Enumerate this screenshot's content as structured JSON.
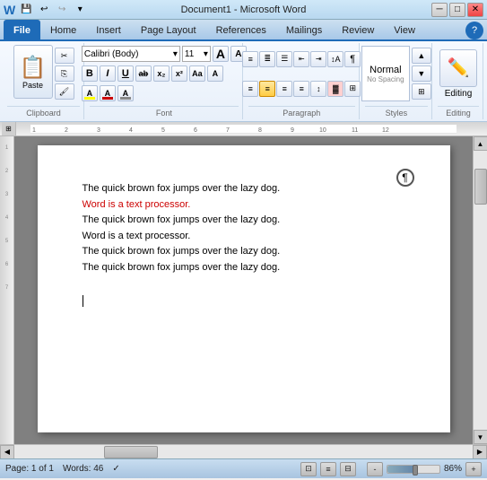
{
  "titlebar": {
    "title": "Document1 - Microsoft Word",
    "min_btn": "─",
    "max_btn": "□",
    "close_btn": "✕"
  },
  "quickaccess": {
    "save_btn": "💾",
    "undo_btn": "↩",
    "redo_btn": "↪",
    "dropdown_btn": "▾"
  },
  "tabs": [
    {
      "label": "File",
      "active": true,
      "id": "file"
    },
    {
      "label": "Home",
      "active": false,
      "id": "home"
    },
    {
      "label": "Insert",
      "active": false,
      "id": "insert"
    },
    {
      "label": "Page Layout",
      "active": false,
      "id": "page-layout"
    },
    {
      "label": "References",
      "active": false,
      "id": "references"
    },
    {
      "label": "Mailings",
      "active": false,
      "id": "mailings"
    },
    {
      "label": "Review",
      "active": false,
      "id": "review"
    },
    {
      "label": "View",
      "active": false,
      "id": "view"
    }
  ],
  "ribbon": {
    "clipboard_group": {
      "label": "Clipboard",
      "paste_label": "Paste",
      "cut_label": "✂",
      "copy_label": "⎘",
      "format_painter_label": "🖌"
    },
    "font_group": {
      "label": "Font",
      "font_name": "Calibri (Body)",
      "font_size": "11",
      "bold": "B",
      "italic": "I",
      "underline": "U",
      "strikethrough": "ab",
      "subscript": "x₂",
      "superscript": "x²",
      "change_case": "Aa",
      "grow": "A",
      "shrink": "A",
      "text_highlight": "A",
      "font_color": "A"
    },
    "paragraph_group": {
      "label": "Paragraph",
      "bullets": "≡",
      "numbering": "≣",
      "multilevel": "☰",
      "decrease_indent": "←",
      "increase_indent": "→",
      "sort": "↕",
      "show_hide": "¶",
      "align_left": "◧",
      "align_center": "▣",
      "align_right": "◨",
      "justify": "⊟",
      "line_spacing": "↕",
      "shading": "▓",
      "borders": "⊞"
    },
    "styles_group": {
      "label": "Styles",
      "normal": "Normal",
      "no_spacing": "No Spacing"
    },
    "editing_group": {
      "label": "Editing",
      "icon": "✏"
    }
  },
  "document": {
    "lines": [
      {
        "text": "The quick brown fox jumps over the lazy dog.",
        "color": "black"
      },
      {
        "text": "Word is a text processor.",
        "color": "red"
      },
      {
        "text": "The quick brown fox jumps over the lazy dog.",
        "color": "black"
      },
      {
        "text": "Word is a text processor.",
        "color": "black"
      },
      {
        "text": "The quick brown fox jumps over the lazy dog.",
        "color": "black"
      },
      {
        "text": "The quick brown fox jumps over the lazy dog.",
        "color": "black"
      }
    ],
    "cursor_line": 6,
    "cursor_char": 10
  },
  "statusbar": {
    "page_info": "Page: 1 of 1",
    "words_info": "Words: 46",
    "language_icon": "✓",
    "view_btns": [
      "⊡",
      "≡",
      "⊟"
    ],
    "zoom_pct": "86%",
    "zoom_out": "-",
    "zoom_in": "+"
  }
}
